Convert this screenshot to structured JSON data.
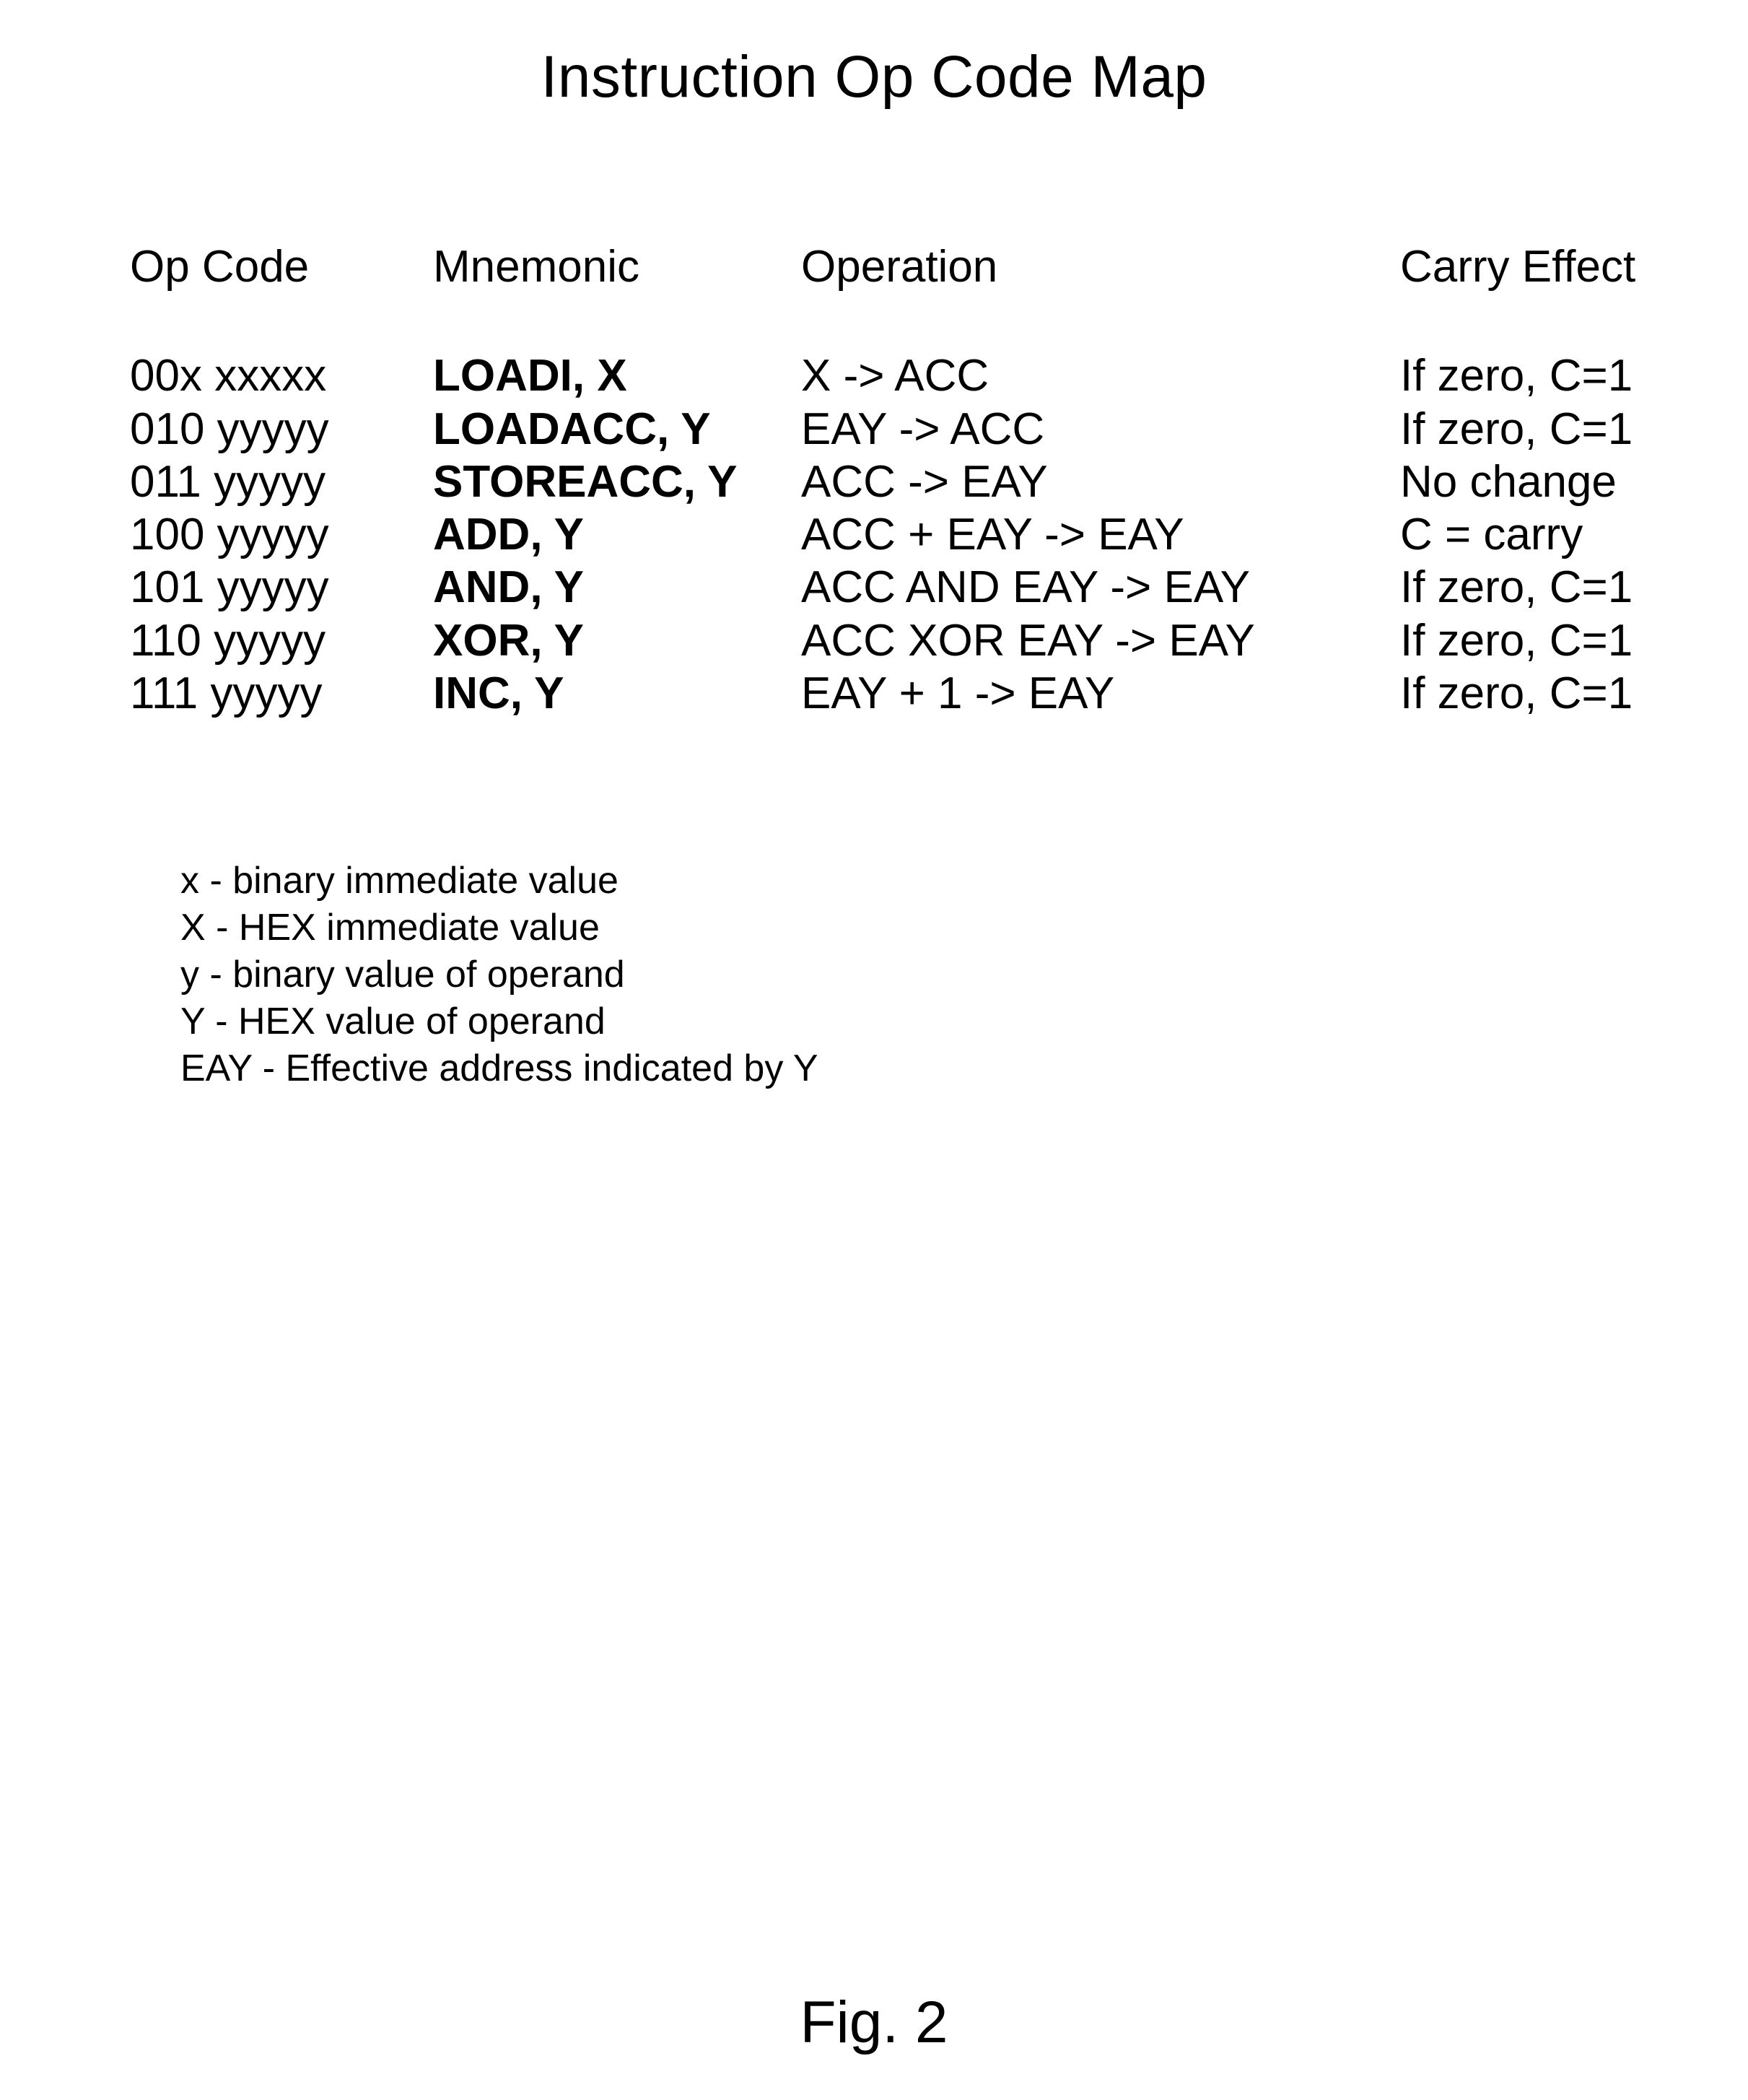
{
  "title": "Instruction Op Code Map",
  "headers": {
    "opcode": "Op Code",
    "mnemonic": "Mnemonic",
    "operation": "Operation",
    "carry": "Carry Effect"
  },
  "rows": [
    {
      "opcode": "00x xxxxx",
      "mnemonic": "LOADI, X",
      "operation": "X -> ACC",
      "carry": "If zero, C=1"
    },
    {
      "opcode": "010 yyyyy",
      "mnemonic": "LOADACC, Y",
      "operation": "EAY -> ACC",
      "carry": "If zero, C=1"
    },
    {
      "opcode": "011 yyyyy",
      "mnemonic": "STOREACC, Y",
      "operation": "ACC -> EAY",
      "carry": "No change"
    },
    {
      "opcode": "100 yyyyy",
      "mnemonic": "ADD, Y",
      "operation": "ACC + EAY -> EAY",
      "carry": "C = carry"
    },
    {
      "opcode": "101 yyyyy",
      "mnemonic": "AND, Y",
      "operation": "ACC AND EAY -> EAY",
      "carry": "If zero, C=1"
    },
    {
      "opcode": "110 yyyyy",
      "mnemonic": "XOR, Y",
      "operation": "ACC XOR EAY -> EAY",
      "carry": "If zero, C=1"
    },
    {
      "opcode": "111 yyyyy",
      "mnemonic": "INC, Y",
      "operation": "EAY + 1 -> EAY",
      "carry": "If zero, C=1"
    }
  ],
  "legend": [
    "x - binary immediate value",
    "X - HEX immediate value",
    "y - binary value of operand",
    "Y - HEX value of operand",
    "EAY - Effective address indicated by Y"
  ],
  "figure_label": "Fig. 2"
}
